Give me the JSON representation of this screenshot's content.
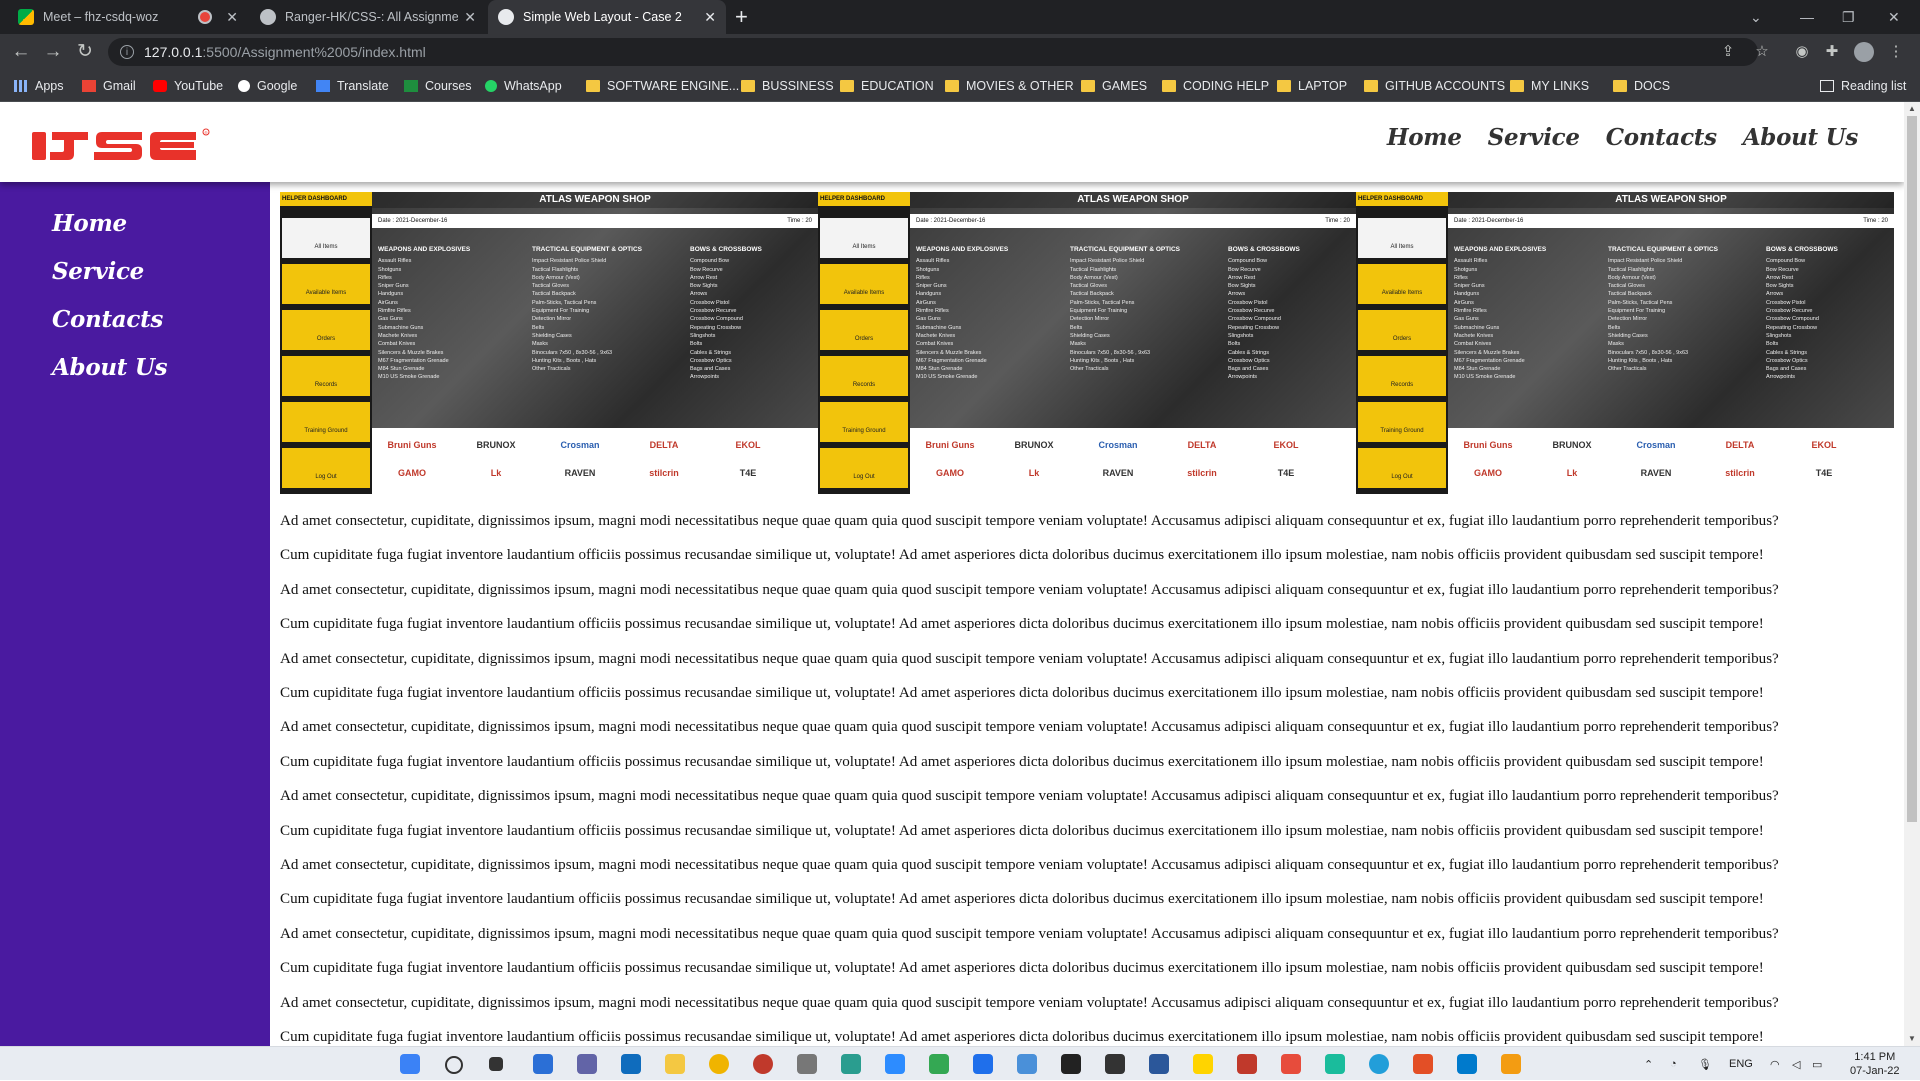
{
  "browser": {
    "tabs": [
      {
        "title": "Meet – fhz-csdq-woz",
        "icon": "meet-icon",
        "active": false
      },
      {
        "title": "Ranger-HK/CSS-: All Assignments",
        "icon": "github-icon",
        "active": false
      },
      {
        "title": "Simple Web Layout - Case 2",
        "icon": "globe-icon",
        "active": true
      }
    ],
    "url": "127.0.0.1",
    "url_path": ":5500/Assignment%2005/index.html",
    "bookmarks": [
      {
        "label": "Apps",
        "icon": "apps-grid-icon"
      },
      {
        "label": "Gmail",
        "icon": "gmail-icon"
      },
      {
        "label": "YouTube",
        "icon": "youtube-icon"
      },
      {
        "label": "Google",
        "icon": "google-icon"
      },
      {
        "label": "Translate",
        "icon": "translate-icon"
      },
      {
        "label": "Courses",
        "icon": "classroom-icon"
      },
      {
        "label": "WhatsApp",
        "icon": "whatsapp-icon"
      },
      {
        "label": "SOFTWARE ENGINE...",
        "icon": "folder-icon"
      },
      {
        "label": "BUSSINESS",
        "icon": "folder-icon"
      },
      {
        "label": "EDUCATION",
        "icon": "folder-icon"
      },
      {
        "label": "MOVIES & OTHER",
        "icon": "folder-icon"
      },
      {
        "label": "GAMES",
        "icon": "folder-icon"
      },
      {
        "label": "CODING HELP",
        "icon": "folder-icon"
      },
      {
        "label": "LAPTOP",
        "icon": "folder-icon"
      },
      {
        "label": "GITHUB ACCOUNTS",
        "icon": "folder-icon"
      },
      {
        "label": "MY LINKS",
        "icon": "folder-icon"
      },
      {
        "label": "DOCS",
        "icon": "folder-icon"
      }
    ],
    "reading_list": "Reading list"
  },
  "site": {
    "logo_text": "IJSE",
    "brand_color": "#e8322a",
    "sidebar_color": "#4a1aa0",
    "top_nav": [
      "Home",
      "Service",
      "Contacts",
      "About Us"
    ],
    "side_nav": [
      "Home",
      "Service",
      "Contacts",
      "About Us"
    ],
    "banner": {
      "title": "ATLAS WEAPON SHOP",
      "dashboard_label": "HELPER DASHBOARD",
      "date": "Date :  2021-December-16",
      "time": "Time :  20",
      "menu": [
        "All Items",
        "Available Items",
        "Orders",
        "Records",
        "Training Ground",
        "Log Out"
      ],
      "columns": [
        {
          "heading": "WEAPONS AND EXPLOSIVES",
          "items": [
            "Assault Rifles",
            "Shotguns",
            "Rifles",
            "Sniper Guns",
            "Handguns",
            "AirGuns",
            "Rimfire Rifles",
            "Gas Guns",
            "Submachine Guns",
            "Machete Knives",
            "Combat Knives",
            "Silencers & Muzzle Brakes",
            "M67 Fragmentation Grenade",
            "M84 Stun Grenade",
            "M10 US Smoke Grenade"
          ]
        },
        {
          "heading": "TRACTICAL EQUIPMENT & OPTICS",
          "items": [
            "Impact Resistant Police Shield",
            "Tactical Flashlights",
            "Body Armour (Vest)",
            "Tactical Gloves",
            "Tactical Backpack",
            "Palm-Sticks, Tactical Pens",
            "Equipment For Training",
            "Detection Mirror",
            "Belts",
            "Shielding Cases",
            "Masks",
            "Binoculars 7x50 , 8x30-56 , 9x63",
            "Hunting Kits , Boots , Hats",
            "Other Tracticals"
          ]
        },
        {
          "heading": "BOWS & CROSSBOWS",
          "items": [
            "Compound Bow",
            "Bow Recurve",
            "Arrow Rest",
            "Bow Sights",
            "Arrows",
            "Crossbow Pistol",
            "Crossbow Recurve",
            "Crossbow Compound",
            "Repeating Crossbow",
            "Slingshots",
            "Bolts",
            "Cables & Strings",
            "Crossbow Optics",
            "Bags and Cases",
            "Arrowpoints"
          ]
        }
      ],
      "brands_row1": [
        "Bruni Guns",
        "BRUNOX",
        "Crosman",
        "DELTA",
        "EKOL"
      ],
      "brands_row2": [
        "GAMO",
        "Lk",
        "RAVEN",
        "stilcrin",
        "T4E"
      ]
    },
    "paragraph_a": "Ad amet consectetur, cupiditate, dignissimos ipsum, magni modi necessitatibus neque quae quam quia quod suscipit tempore veniam voluptate! Accusamus adipisci aliquam consequuntur et ex, fugiat illo laudantium porro reprehenderit temporibus?",
    "paragraph_b": "Cum cupiditate fuga fugiat inventore laudantium officiis possimus recusandae similique ut, voluptate! Ad amet asperiores dicta doloribus ducimus exercitationem illo ipsum molestiae, nam nobis officiis provident quibusdam sed suscipit tempore!"
  },
  "taskbar": {
    "language": "ENG",
    "time": "1:41 PM",
    "date": "07-Jan-22"
  }
}
